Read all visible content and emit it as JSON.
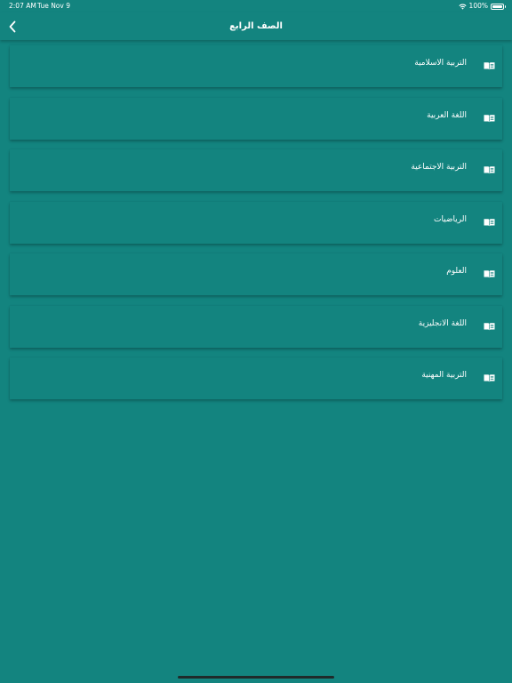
{
  "status_bar": {
    "time": "2:07 AM",
    "date": "Tue Nov 9",
    "battery": "100%",
    "wifi_icon": "wifi-icon",
    "battery_icon": "battery-icon"
  },
  "nav": {
    "title": "الصف الرابع",
    "back_icon": "chevron-left-icon"
  },
  "theme": {
    "background": "#13847f",
    "text": "#ffffff"
  },
  "subjects": [
    {
      "label": "التربية الاسلامية",
      "icon": "book-icon"
    },
    {
      "label": "اللغة العربية",
      "icon": "book-icon"
    },
    {
      "label": "التربية الاجتماعية",
      "icon": "book-icon"
    },
    {
      "label": "الرياضيات",
      "icon": "book-icon"
    },
    {
      "label": "العلوم",
      "icon": "book-icon"
    },
    {
      "label": "اللغة الانجليزية",
      "icon": "book-icon"
    },
    {
      "label": "التربية المهنية",
      "icon": "book-icon"
    }
  ]
}
